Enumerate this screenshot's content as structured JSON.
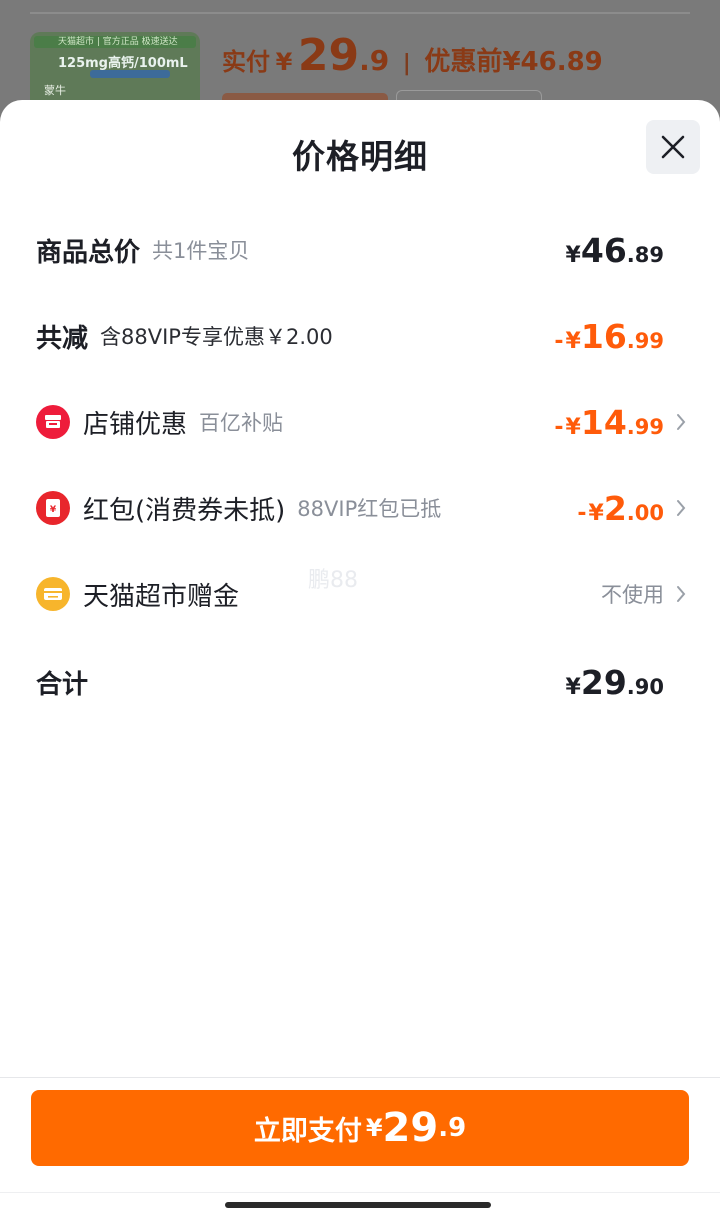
{
  "background": {
    "product_thumb": {
      "banner_text": "天猫超市 | 官方正品 极速送达",
      "headline": "125mg高钙/100mL",
      "brand": "蒙牛"
    },
    "price_bar": {
      "paid_label": "实付",
      "currency": "¥",
      "paid_int": "29",
      "paid_dec": ".9",
      "separator": "|",
      "original_label": "优惠前",
      "original_price": "¥46.89"
    }
  },
  "sheet": {
    "title": "价格明细",
    "close_icon": "close-icon",
    "rows": {
      "total": {
        "name": "商品总价",
        "sub": "共1件宝贝",
        "currency": "¥",
        "int": "46",
        "dec": ".89"
      },
      "discount": {
        "name": "共减",
        "sub": "含88VIP专享优惠￥2.00",
        "minus": "-",
        "currency": "¥",
        "int": "16",
        "dec": ".99"
      },
      "shop": {
        "icon": "store-icon",
        "name": "店铺优惠",
        "sub": "百亿补贴",
        "minus": "-",
        "currency": "¥",
        "int": "14",
        "dec": ".99"
      },
      "redpacket": {
        "icon": "red-packet-icon",
        "name": "红包(消费券未抵)",
        "sub": "88VIP红包已抵",
        "minus": "-",
        "currency": "¥",
        "int": "2",
        "dec": ".00"
      },
      "gift": {
        "icon": "gift-card-icon",
        "name": "天猫超市赠金",
        "value": "不使用"
      },
      "sum": {
        "name": "合计",
        "currency": "¥",
        "int": "29",
        "dec": ".90"
      }
    },
    "watermark": "鹏88"
  },
  "footer": {
    "pay_label": "立即支付",
    "currency": "¥",
    "int": "29",
    "dec": ".9"
  },
  "colors": {
    "accent_orange": "#ff6a00",
    "discount_orange": "#ff5b0a",
    "text_dark": "#1d1f26",
    "text_muted": "#8a8f99",
    "shop_icon_red": "#ee1c3b",
    "redpacket_icon_red": "#e8262c",
    "gift_icon_yellow": "#f7b52c"
  }
}
